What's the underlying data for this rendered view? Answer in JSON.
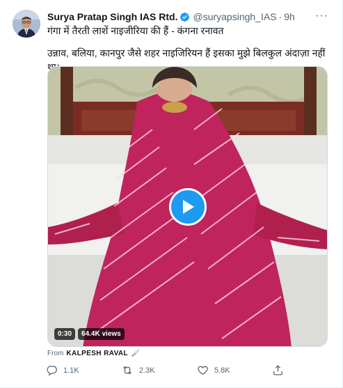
{
  "tweet": {
    "author_name": "Surya Pratap Singh IAS Rtd.",
    "handle": "@suryapsingh_IAS",
    "separator": "·",
    "time": "9h",
    "more_label": "···",
    "subline": "गंगा में तैरती लाशें नाइजीरिया की हैं - कंगना रनावत",
    "text": "उन्नाव, बलिया, कानपुर जैसे शहर नाइजिरियन हैं इसका मुझे बिलकुल अंदाज़ा नहीं था।",
    "verified_icon": "verified-badge-icon",
    "colors": {
      "accent": "#1d9bf0",
      "video_dress": "#c0245d"
    }
  },
  "video": {
    "duration": "0:30",
    "views": "64.4K views",
    "play_icon": "play-icon"
  },
  "source": {
    "prefix": "From",
    "name": "KALPESH RAVAL",
    "emoji": "🖌"
  },
  "actions": {
    "reply_count": "1.1K",
    "retweet_count": "2.3K",
    "like_count": "5.8K"
  }
}
